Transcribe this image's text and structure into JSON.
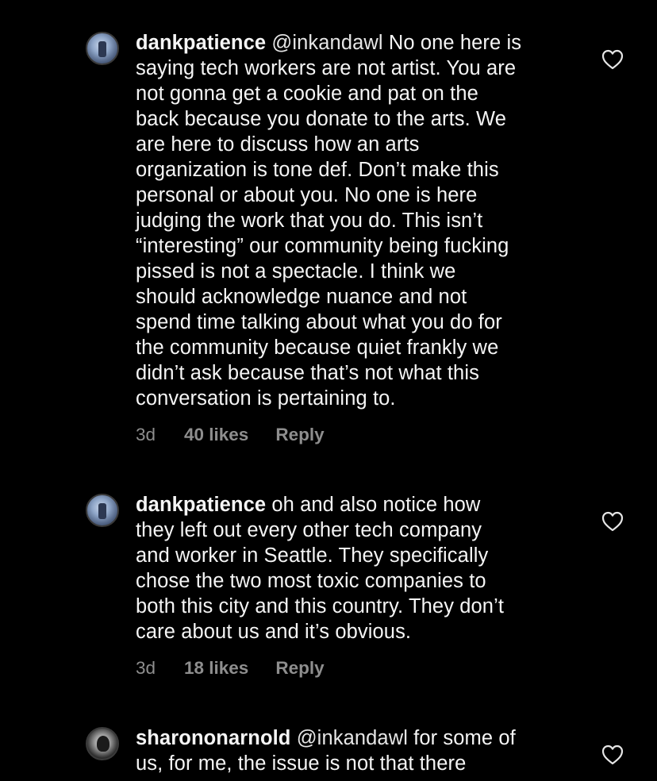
{
  "comments": [
    {
      "username": "dankpatience",
      "mention": "@inkandawl",
      "lines": [
        " No one here is",
        "saying tech workers are not artist. You are",
        "not gonna get a cookie and pat on the",
        "back because you donate to the arts. We",
        "are here to discuss how an arts",
        "organization is tone def. Don’t make this",
        "personal or about you. No one is here",
        "judging the work that you do. This isn’t",
        "“interesting” our community being fucking",
        "pissed is not a spectacle. I think we",
        "should acknowledge nuance and not",
        "spend time talking about what you do for",
        "the community because quiet frankly we",
        "didn’t ask because that’s not what this",
        "conversation is pertaining to."
      ],
      "time": "3d",
      "likes": "40 likes",
      "reply": "Reply",
      "avatar_icon": "profile-photo",
      "like_icon": "heart-outline-icon"
    },
    {
      "username": "dankpatience",
      "mention": "",
      "lines": [
        " oh and also notice how",
        "they left out every other tech company",
        "and worker in Seattle. They specifically",
        "chose the two most toxic companies to",
        "both this city and this country. They don’t",
        "care about us and it’s obvious."
      ],
      "time": "3d",
      "likes": "18 likes",
      "reply": "Reply",
      "avatar_icon": "profile-photo",
      "like_icon": "heart-outline-icon"
    },
    {
      "username": "sharononarnold",
      "mention": "@inkandawl",
      "lines": [
        " for some of",
        "us, for me, the issue is not that there"
      ],
      "avatar_icon": "profile-photo",
      "like_icon": "heart-outline-icon"
    }
  ],
  "colors": {
    "background": "#000000",
    "text": "#f5f5f5",
    "meta": "#8e8e8e"
  }
}
